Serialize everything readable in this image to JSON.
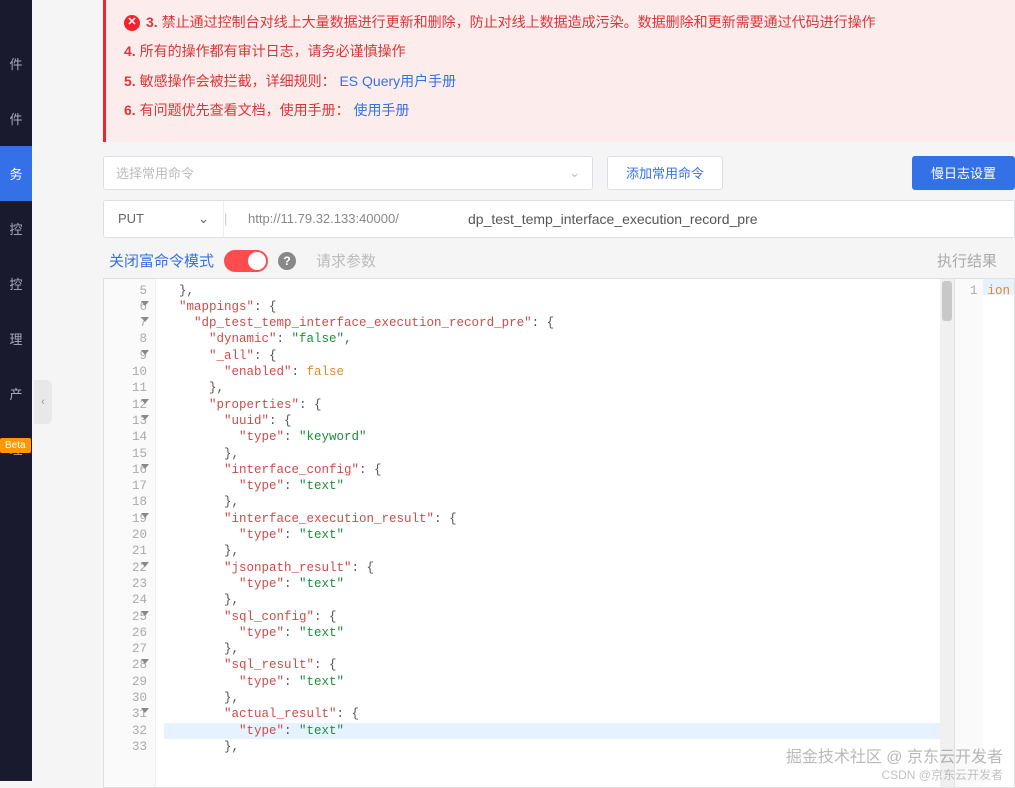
{
  "sidebar": {
    "items": [
      "",
      "件",
      "件",
      "务",
      "控",
      "控",
      "理",
      "产",
      "理"
    ],
    "beta": "Beta"
  },
  "notice": {
    "items": [
      {
        "n": "3.",
        "text": "禁止通过控制台对线上大量数据进行更新和删除，防止对线上数据造成污染。数据删除和更新需要通过代码进行操作",
        "icon": true
      },
      {
        "n": "4.",
        "text": "所有的操作都有审计日志，请务必谨慎操作"
      },
      {
        "n": "5.",
        "text": "敏感操作会被拦截，详细规则：",
        "link": "ES Query用户手册"
      },
      {
        "n": "6.",
        "text": "有问题优先查看文档，使用手册：",
        "link": "使用手册"
      }
    ]
  },
  "toolbar": {
    "select_placeholder": "选择常用命令",
    "add_cmd": "添加常用命令",
    "slowlog": "慢日志设置"
  },
  "request": {
    "method": "PUT",
    "url": "http://11.79.32.133:40000/",
    "index": "dp_test_temp_interface_execution_record_pre"
  },
  "mode": {
    "label": "关闭富命令模式",
    "params": "请求参数",
    "result": "执行结果"
  },
  "code_lines": [
    {
      "n": 5,
      "fold": false,
      "t": [
        [
          "pun",
          "  },"
        ]
      ]
    },
    {
      "n": 6,
      "fold": true,
      "t": [
        [
          "pun",
          "  "
        ],
        [
          "prop",
          "\"mappings\""
        ],
        [
          "pun",
          ": {"
        ]
      ]
    },
    {
      "n": 7,
      "fold": true,
      "t": [
        [
          "pun",
          "    "
        ],
        [
          "prop",
          "\"dp_test_temp_interface_execution_record_pre\""
        ],
        [
          "pun",
          ": {"
        ]
      ]
    },
    {
      "n": 8,
      "fold": false,
      "t": [
        [
          "pun",
          "      "
        ],
        [
          "prop",
          "\"dynamic\""
        ],
        [
          "pun",
          ": "
        ],
        [
          "str",
          "\"false\""
        ],
        [
          "pun",
          ","
        ]
      ]
    },
    {
      "n": 9,
      "fold": true,
      "t": [
        [
          "pun",
          "      "
        ],
        [
          "prop",
          "\"_all\""
        ],
        [
          "pun",
          ": {"
        ]
      ]
    },
    {
      "n": 10,
      "fold": false,
      "t": [
        [
          "pun",
          "        "
        ],
        [
          "prop",
          "\"enabled\""
        ],
        [
          "pun",
          ": "
        ],
        [
          "kw",
          "false"
        ]
      ]
    },
    {
      "n": 11,
      "fold": false,
      "t": [
        [
          "pun",
          "      },"
        ]
      ]
    },
    {
      "n": 12,
      "fold": true,
      "t": [
        [
          "pun",
          "      "
        ],
        [
          "prop",
          "\"properties\""
        ],
        [
          "pun",
          ": {"
        ]
      ]
    },
    {
      "n": 13,
      "fold": true,
      "t": [
        [
          "pun",
          "        "
        ],
        [
          "prop",
          "\"uuid\""
        ],
        [
          "pun",
          ": {"
        ]
      ]
    },
    {
      "n": 14,
      "fold": false,
      "t": [
        [
          "pun",
          "          "
        ],
        [
          "prop",
          "\"type\""
        ],
        [
          "pun",
          ": "
        ],
        [
          "str",
          "\"keyword\""
        ]
      ]
    },
    {
      "n": 15,
      "fold": false,
      "t": [
        [
          "pun",
          "        },"
        ]
      ]
    },
    {
      "n": 16,
      "fold": true,
      "t": [
        [
          "pun",
          "        "
        ],
        [
          "prop",
          "\"interface_config\""
        ],
        [
          "pun",
          ": {"
        ]
      ]
    },
    {
      "n": 17,
      "fold": false,
      "t": [
        [
          "pun",
          "          "
        ],
        [
          "prop",
          "\"type\""
        ],
        [
          "pun",
          ": "
        ],
        [
          "str",
          "\"text\""
        ]
      ]
    },
    {
      "n": 18,
      "fold": false,
      "t": [
        [
          "pun",
          "        },"
        ]
      ]
    },
    {
      "n": 19,
      "fold": true,
      "t": [
        [
          "pun",
          "        "
        ],
        [
          "prop",
          "\"interface_execution_result\""
        ],
        [
          "pun",
          ": {"
        ]
      ]
    },
    {
      "n": 20,
      "fold": false,
      "t": [
        [
          "pun",
          "          "
        ],
        [
          "prop",
          "\"type\""
        ],
        [
          "pun",
          ": "
        ],
        [
          "str",
          "\"text\""
        ]
      ]
    },
    {
      "n": 21,
      "fold": false,
      "t": [
        [
          "pun",
          "        },"
        ]
      ]
    },
    {
      "n": 22,
      "fold": true,
      "t": [
        [
          "pun",
          "        "
        ],
        [
          "prop",
          "\"jsonpath_result\""
        ],
        [
          "pun",
          ": {"
        ]
      ]
    },
    {
      "n": 23,
      "fold": false,
      "t": [
        [
          "pun",
          "          "
        ],
        [
          "prop",
          "\"type\""
        ],
        [
          "pun",
          ": "
        ],
        [
          "str",
          "\"text\""
        ]
      ]
    },
    {
      "n": 24,
      "fold": false,
      "t": [
        [
          "pun",
          "        },"
        ]
      ]
    },
    {
      "n": 25,
      "fold": true,
      "t": [
        [
          "pun",
          "        "
        ],
        [
          "prop",
          "\"sql_config\""
        ],
        [
          "pun",
          ": {"
        ]
      ]
    },
    {
      "n": 26,
      "fold": false,
      "t": [
        [
          "pun",
          "          "
        ],
        [
          "prop",
          "\"type\""
        ],
        [
          "pun",
          ": "
        ],
        [
          "str",
          "\"text\""
        ]
      ]
    },
    {
      "n": 27,
      "fold": false,
      "t": [
        [
          "pun",
          "        },"
        ]
      ]
    },
    {
      "n": 28,
      "fold": true,
      "t": [
        [
          "pun",
          "        "
        ],
        [
          "prop",
          "\"sql_result\""
        ],
        [
          "pun",
          ": {"
        ]
      ]
    },
    {
      "n": 29,
      "fold": false,
      "t": [
        [
          "pun",
          "          "
        ],
        [
          "prop",
          "\"type\""
        ],
        [
          "pun",
          ": "
        ],
        [
          "str",
          "\"text\""
        ]
      ]
    },
    {
      "n": 30,
      "fold": false,
      "t": [
        [
          "pun",
          "        },"
        ]
      ]
    },
    {
      "n": 31,
      "fold": true,
      "t": [
        [
          "pun",
          "        "
        ],
        [
          "prop",
          "\"actual_result\""
        ],
        [
          "pun",
          ": {"
        ]
      ]
    },
    {
      "n": 32,
      "fold": false,
      "hl": true,
      "t": [
        [
          "pun",
          "          "
        ],
        [
          "prop",
          "\"type\""
        ],
        [
          "pun",
          ": "
        ],
        [
          "str",
          "\"text\""
        ]
      ]
    },
    {
      "n": 33,
      "fold": false,
      "t": [
        [
          "pun",
          "        },"
        ]
      ]
    }
  ],
  "result_pane": {
    "line_no": "1",
    "text": "ion"
  },
  "watermark": {
    "l1": "掘金技术社区 @ 京东云开发者",
    "l2": "CSDN @京东云开发者"
  }
}
